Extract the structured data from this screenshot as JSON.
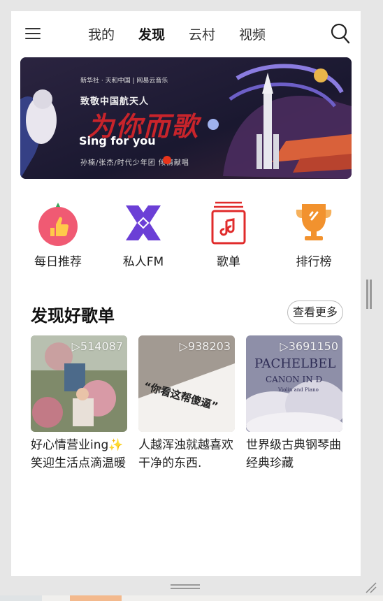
{
  "header": {
    "tabs": [
      {
        "label": "我的",
        "active": false
      },
      {
        "label": "发现",
        "active": true
      },
      {
        "label": "云村",
        "active": false
      },
      {
        "label": "视频",
        "active": false
      }
    ],
    "menu_icon": "hamburger-menu-icon",
    "search_icon": "search-icon"
  },
  "banner": {
    "sponsor": "新华社 · 天和中国 | 网易云音乐",
    "subtitle": "致敬中国航天人",
    "headline": "为你而歌",
    "english": "Sing for you",
    "artists": "孙楠/张杰/时代少年团 倾情献唱"
  },
  "shortcuts": [
    {
      "label": "每日推荐",
      "icon": "daily-recommend-icon",
      "color": "#f05a73"
    },
    {
      "label": "私人FM",
      "icon": "personal-fm-icon",
      "color": "#6b3fd6"
    },
    {
      "label": "歌单",
      "icon": "playlist-icon",
      "color": "#e02b2b"
    },
    {
      "label": "排行榜",
      "icon": "trophy-icon",
      "color": "#f2922e"
    }
  ],
  "section": {
    "title": "发现好歌单",
    "more_label": "查看更多"
  },
  "playlists": [
    {
      "plays": "▷514087",
      "title": "好心情营业ing✨笑迎生活点滴温暖"
    },
    {
      "plays": "▷938203",
      "title": "人越浑浊就越喜欢干净的东西."
    },
    {
      "plays": "▷3691150",
      "title": "世界级古典钢琴曲经典珍藏",
      "cover_text_1": "PACHELBEL",
      "cover_text_2": "CANON IN D",
      "cover_text_3": "Violin and Piano"
    }
  ],
  "cover2_text": "“你看这帮傻逼”",
  "colors": {
    "accent": "#e8341b",
    "background": "#e6e6e6"
  }
}
